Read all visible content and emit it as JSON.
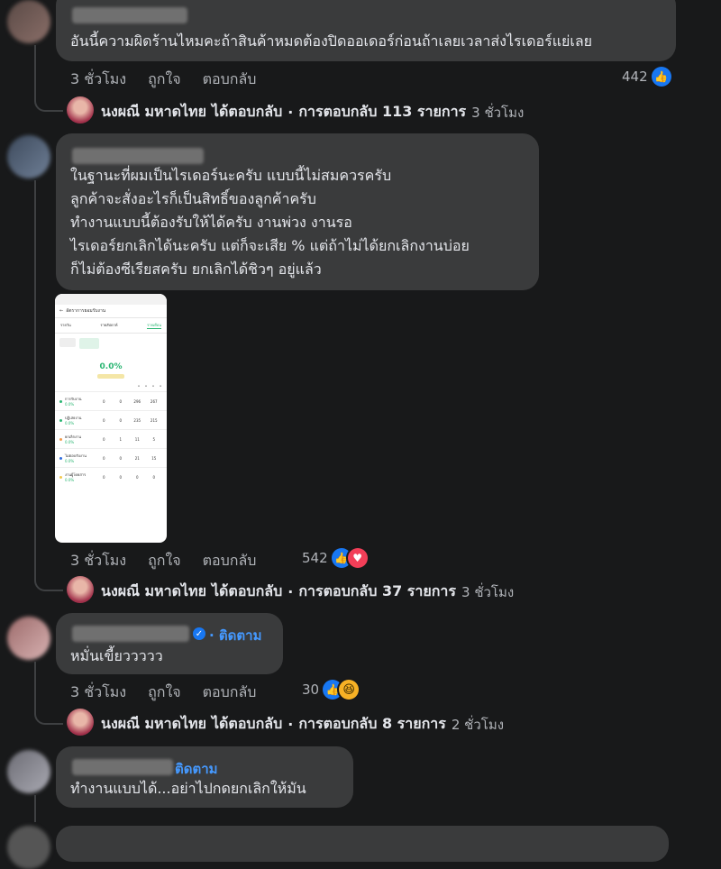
{
  "comments": [
    {
      "text_lines": [
        "อันนี้ความผิดร้านไหมคะถ้าสินค้าหมดต้องปิดออเดอร์ก่อนถ้าเลยเวลาส่งไรเดอร์แย่เลย"
      ],
      "time": "3 ชั่วโมง",
      "like_label": "ถูกใจ",
      "reply_label": "ตอบกลับ",
      "reaction_count": "442",
      "reactions": [
        "like-icon"
      ],
      "reply_summary": {
        "name": "นงผณี มหาดไทย",
        "action": "ได้ตอบกลับ",
        "sep": "·",
        "count_text": "การตอบกลับ 113 รายการ",
        "time": "3 ชั่วโมง"
      }
    },
    {
      "text_lines": [
        "ในฐานะที่ผมเป็นไรเดอร์นะครับ แบบนี้ไม่สมควรครับ",
        "ลูกค้าจะสั่งอะไรก็เป็นสิทธิ์ของลูกค้าครับ",
        "ทำงานแบบนี้ต้องรับให้ได้ครับ งานพ่วง งานรอ",
        "ไรเดอร์ยกเลิกได้นะครับ แต่ก็จะเสีย % แต่ถ้าไม่ได้ยกเลิกงานบ่อย",
        "ก็ไม่ต้องซีเรียสครับ ยกเลิกได้ชิวๆ อยู่แล้ว"
      ],
      "time": "3 ชั่วโมง",
      "like_label": "ถูกใจ",
      "reply_label": "ตอบกลับ",
      "reaction_count": "542",
      "reactions": [
        "like-icon",
        "love-icon"
      ],
      "attachment": {
        "header": "อัตราการยอมรับงาน",
        "tabs": [
          "รายวัน",
          "รายสัปดาห์",
          "รายเดือน"
        ],
        "percent": "0.0%",
        "rows": [
          {
            "label": "การรับงาน",
            "sub": "0.0%",
            "vals": [
              "0",
              "0",
              "296",
              "267"
            ],
            "color": "#2bb673"
          },
          {
            "label": "ปฏิเสธงาน",
            "sub": "0.0%",
            "vals": [
              "0",
              "0",
              "235",
              "215"
            ],
            "color": "#2bb673"
          },
          {
            "label": "ยกเลิกงาน",
            "sub": "0.0%",
            "vals": [
              "0",
              "1",
              "11",
              "5"
            ],
            "color": "#f2994a"
          },
          {
            "label": "ไม่ตอบรับงาน",
            "sub": "0.0%",
            "vals": [
              "0",
              "0",
              "21",
              "15"
            ],
            "color": "#2d6cdf"
          },
          {
            "label": "งานผู้โดยสาร",
            "sub": "0.0%",
            "vals": [
              "0",
              "0",
              "0",
              "0"
            ],
            "color": "#f2c94c"
          }
        ]
      },
      "reply_summary": {
        "name": "นงผณี มหาดไทย",
        "action": "ได้ตอบกลับ",
        "sep": "·",
        "count_text": "การตอบกลับ 37 รายการ",
        "time": "3 ชั่วโมง"
      }
    },
    {
      "text_lines": [
        "หมั่นเขี้ยววววว"
      ],
      "follow_label": "· ติดตาม",
      "time": "3 ชั่วโมง",
      "like_label": "ถูกใจ",
      "reply_label": "ตอบกลับ",
      "reaction_count": "30",
      "reactions": [
        "like-icon",
        "haha-icon"
      ],
      "reply_summary": {
        "name": "นงผณี มหาดไทย",
        "action": "ได้ตอบกลับ",
        "sep": "·",
        "count_text": "การตอบกลับ 8 รายการ",
        "time": "2 ชั่วโมง"
      }
    },
    {
      "text_lines": [
        "ทำงานแบบได้...อย่าไปกดยกเลิกให้มัน"
      ],
      "follow_label": "ติดตาม"
    }
  ],
  "colors": {
    "bg": "#18191a",
    "bubble": "#3a3b3c",
    "like": "#1877f2",
    "love": "#f33e58",
    "haha": "#f7b125",
    "link": "#4599ff"
  }
}
